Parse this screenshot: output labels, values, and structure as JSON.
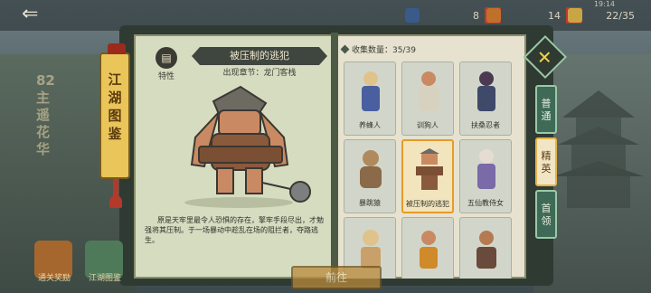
{
  "topbar": {
    "resources": [
      {
        "icon": "bird-icon",
        "value": "8",
        "color": "#3a5a8a"
      },
      {
        "icon": "horse-icon",
        "value": "14",
        "color": "#c0702a"
      },
      {
        "icon": "coin-pouch-icon",
        "value": "22/35",
        "color": "#c9a645"
      }
    ],
    "plus_label": "+",
    "clock": "19:14"
  },
  "background": {
    "side_text": "82主遥花华"
  },
  "vertical_tag": {
    "label": "江湖图鉴"
  },
  "detail": {
    "trait_label": "特性",
    "name": "被压制的逃犯",
    "chapter": "出现章节：龙门客栈",
    "description": "原是天牢里最令人恐惧的存在，擎牢手段尽出，才勉强将其压制。于一场暴动中趁乱在场的阻拦者，夺路逃生。"
  },
  "collection": {
    "label": "收集数量：35/39",
    "cards": [
      {
        "name": "养蜂人",
        "selected": false
      },
      {
        "name": "训狗人",
        "selected": false
      },
      {
        "name": "扶桑忍者",
        "selected": false
      },
      {
        "name": "暴跳猿",
        "selected": false
      },
      {
        "name": "被压制的逃犯",
        "selected": true
      },
      {
        "name": "五仙教侍女",
        "selected": false
      },
      {
        "name": "",
        "selected": false
      },
      {
        "name": "",
        "selected": false
      },
      {
        "name": "",
        "selected": false
      }
    ]
  },
  "tabs": {
    "close_label": "✕",
    "items": [
      {
        "label": "普通",
        "active": false
      },
      {
        "label": "精英",
        "active": true
      },
      {
        "label": "首领",
        "active": false
      }
    ]
  },
  "bottom": {
    "go_button": "前往",
    "left_buttons": [
      {
        "label": "通关奖励"
      },
      {
        "label": "江湖图鉴"
      }
    ]
  }
}
